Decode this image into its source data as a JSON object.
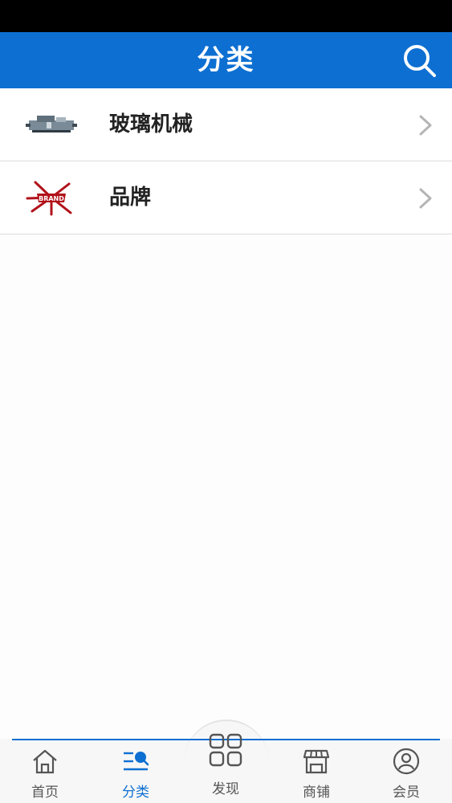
{
  "header": {
    "title": "分类"
  },
  "categories": [
    {
      "label": "玻璃机械"
    },
    {
      "label": "品牌"
    }
  ],
  "tabbar": {
    "items": [
      {
        "label": "首页",
        "icon": "home-icon"
      },
      {
        "label": "分类",
        "icon": "category-icon",
        "active": true
      },
      {
        "label": "发现",
        "icon": "grid-icon"
      },
      {
        "label": "商铺",
        "icon": "store-icon"
      },
      {
        "label": "会员",
        "icon": "user-icon"
      }
    ]
  },
  "colors": {
    "accent": "#0d6fd2",
    "statusbar": "#000000"
  }
}
